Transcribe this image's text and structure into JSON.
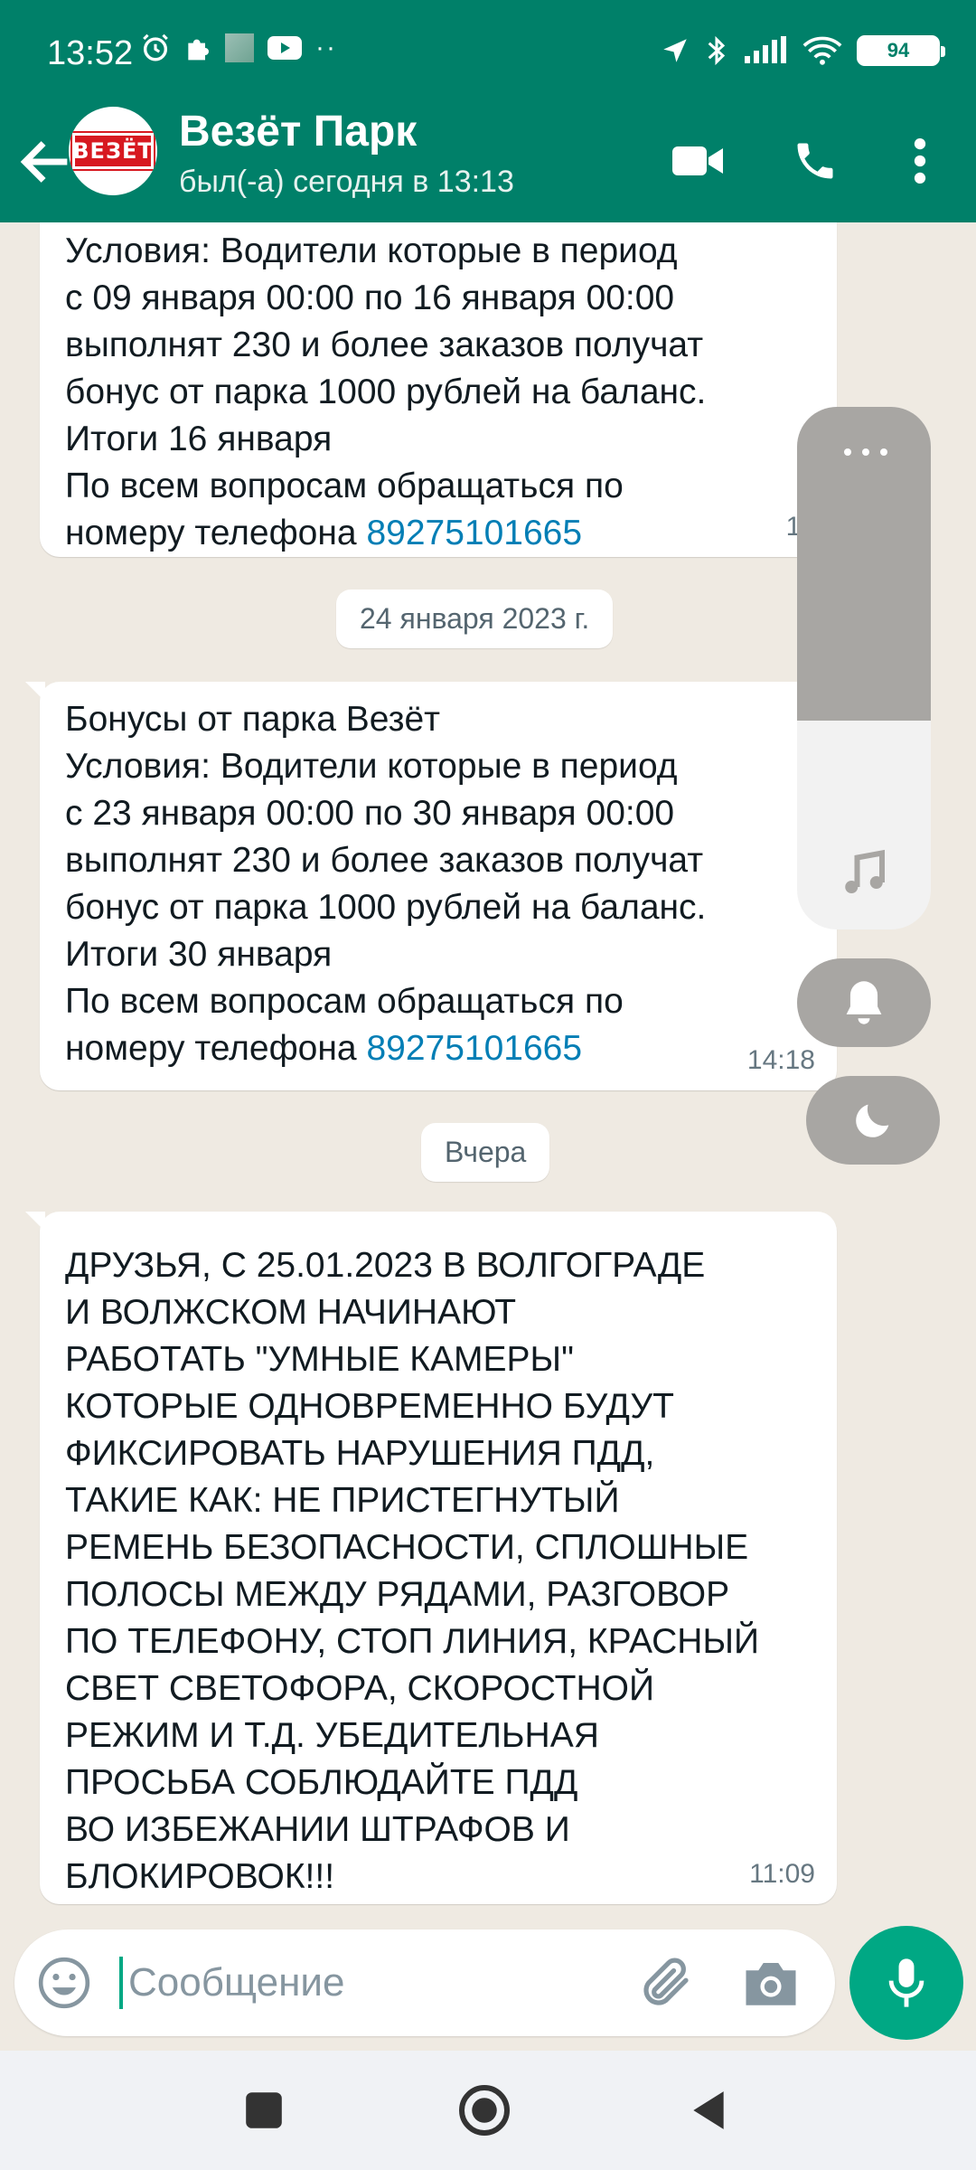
{
  "status_bar": {
    "time": "13:52",
    "battery": "94",
    "icons_left": [
      "alarm-icon",
      "puzzle-icon",
      "blurred-app-icon",
      "youtube-icon",
      "more-dots-icon"
    ],
    "icons_right": [
      "location-icon",
      "bluetooth-icon",
      "signal-icon",
      "wifi-icon",
      "battery-icon"
    ]
  },
  "header": {
    "title": "Везёт Парк",
    "subtitle": "был(-а) сегодня в 13:13",
    "avatar_logo": "ВЕЗЁТ",
    "buttons": [
      "back-arrow-icon",
      "video-call-icon",
      "phone-icon",
      "more-vert-icon"
    ]
  },
  "colors": {
    "header": "#008069",
    "accent": "#00a884",
    "link": "#027eb5",
    "chat_bg": "#efeae2"
  },
  "messages": [
    {
      "lines": [
        "Условия: Водители которые в период",
        "с 09 января 00:00 по 16 января 00:00",
        "выполнят 230 и более заказов получат",
        "бонус от парка 1000 рублей на баланс.",
        "Итоги 16 января",
        "По всем вопросам обращаться по"
      ],
      "last_prefix": "номеру телефона ",
      "phone": "89275101665",
      "time": "16:2"
    },
    {
      "lines": [
        "Бонусы от парка Везёт",
        "Условия: Водители которые в период",
        "с 23 января 00:00 по 30 января 00:00",
        "выполнят 230 и более заказов получат",
        "бонус от парка 1000 рублей на баланс.",
        "Итоги 30 января",
        "По всем вопросам обращаться по"
      ],
      "last_prefix": "номеру телефона ",
      "phone": "89275101665",
      "time": "14:18"
    },
    {
      "lines": [
        "ДРУЗЬЯ, С 25.01.2023 В ВОЛГОГРАДЕ",
        "И ВОЛЖСКОМ НАЧИНАЮТ",
        "РАБОТАТЬ \"УМНЫЕ КАМЕРЫ\"",
        "КОТОРЫЕ ОДНОВРЕМЕННО БУДУТ",
        "ФИКСИРОВАТЬ НАРУШЕНИЯ ПДД,",
        "ТАКИЕ КАК: НЕ ПРИСТЕГНУТЫЙ",
        "РЕМЕНЬ БЕЗОПАСНОСТИ, СПЛОШНЫЕ",
        "ПОЛОСЫ МЕЖДУ РЯДАМИ, РАЗГОВОР",
        "ПО ТЕЛЕФОНУ, СТОП ЛИНИЯ, КРАСНЫЙ",
        "СВЕТ СВЕТОФОРА, СКОРОСТНОЙ",
        "РЕЖИМ И Т.Д. УБЕДИТЕЛЬНАЯ",
        "ПРОСЬБА СОБЛЮДАЙТЕ ПДД",
        "ВО ИЗБЕЖАНИИ ШТРАФОВ И",
        "БЛОКИРОВОК!!!"
      ],
      "time": "11:09"
    }
  ],
  "date_chips": [
    "24 января 2023 г.",
    "Вчера"
  ],
  "volume_overlay": {
    "level": 0.6,
    "icons": [
      "more-dots-icon",
      "music-note-icon",
      "bell-icon",
      "moon-icon"
    ]
  },
  "input": {
    "placeholder": "Сообщение",
    "value": "",
    "icons": [
      "emoji-icon",
      "attach-icon",
      "camera-icon",
      "mic-icon"
    ]
  },
  "navbar": {
    "icons": [
      "recents-square-icon",
      "home-circle-icon",
      "back-triangle-icon"
    ]
  }
}
